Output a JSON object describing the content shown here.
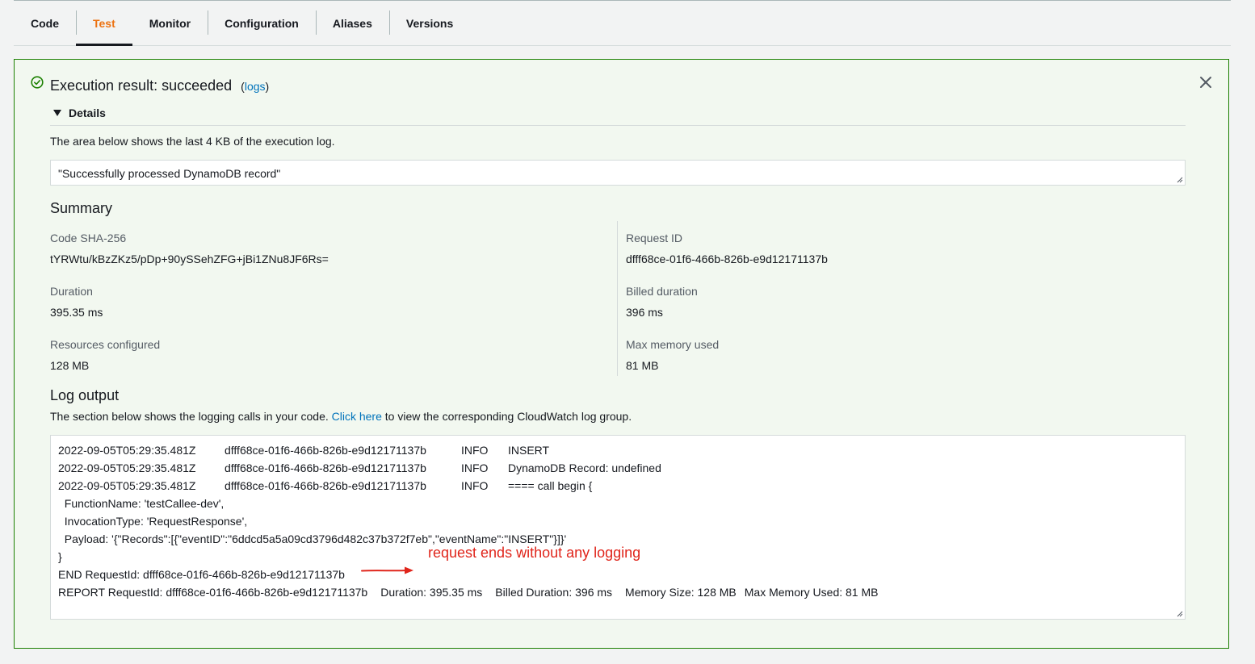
{
  "tabs": [
    {
      "label": "Code",
      "active": false
    },
    {
      "label": "Test",
      "active": true
    },
    {
      "label": "Monitor",
      "active": false
    },
    {
      "label": "Configuration",
      "active": false
    },
    {
      "label": "Aliases",
      "active": false
    },
    {
      "label": "Versions",
      "active": false
    }
  ],
  "result": {
    "title": "Execution result: succeeded",
    "logs_link": "logs",
    "status_color": "#1d8102"
  },
  "details": {
    "label": "Details",
    "area_description": "The area below shows the last 4 KB of the execution log.",
    "output_value": "\"Successfully processed DynamoDB record\""
  },
  "summary": {
    "title": "Summary",
    "code_sha_label": "Code SHA-256",
    "code_sha_value": "tYRWtu/kBzZKz5/pDp+90ySSehZFG+jBi1ZNu8JF6Rs=",
    "request_id_label": "Request ID",
    "request_id_value": "dfff68ce-01f6-466b-826b-e9d12171137b",
    "duration_label": "Duration",
    "duration_value": "395.35 ms",
    "billed_duration_label": "Billed duration",
    "billed_duration_value": "396 ms",
    "resources_label": "Resources configured",
    "resources_value": "128 MB",
    "max_memory_label": "Max memory used",
    "max_memory_value": "81 MB"
  },
  "log_output": {
    "title": "Log output",
    "desc_before": "The section below shows the logging calls in your code.",
    "desc_link": "Click here",
    "desc_after": "to view the corresponding CloudWatch log group.",
    "entries": [
      {
        "ts": "2022-09-05T05:29:35.481Z",
        "id": "dfff68ce-01f6-466b-826b-e9d12171137b",
        "level": "INFO",
        "msg": "INSERT"
      },
      {
        "ts": "2022-09-05T05:29:35.481Z",
        "id": "dfff68ce-01f6-466b-826b-e9d12171137b",
        "level": "INFO",
        "msg": "DynamoDB Record: undefined"
      },
      {
        "ts": "2022-09-05T05:29:35.481Z",
        "id": "dfff68ce-01f6-466b-826b-e9d12171137b",
        "level": "INFO",
        "msg": "==== call begin {"
      }
    ],
    "continuation": [
      "  FunctionName: 'testCallee-dev',",
      "  InvocationType: 'RequestResponse',",
      "  Payload: '{\"Records\":[{\"eventID\":\"6ddcd5a5a09cd3796d482c37b372f7eb\",\"eventName\":\"INSERT\"}]}'",
      "}"
    ],
    "end_line": "END RequestId: dfff68ce-01f6-466b-826b-e9d12171137b",
    "report": {
      "request": "REPORT RequestId: dfff68ce-01f6-466b-826b-e9d12171137b",
      "duration": "Duration: 395.35 ms",
      "billed": "Billed Duration: 396 ms",
      "memory_size": "Memory Size: 128 MB",
      "max_memory": "Max Memory Used: 81 MB"
    }
  },
  "annotation": {
    "text": "request ends without any logging",
    "color": "#e0251b"
  },
  "colors": {
    "active_tab": "#ec7211",
    "link": "#0073bb",
    "panel_background": "#f2f8f0"
  },
  "icons": {
    "success": "check-circle-icon",
    "close": "close-icon",
    "expand": "caret-down-icon",
    "arrow": "arrow-right-icon"
  }
}
